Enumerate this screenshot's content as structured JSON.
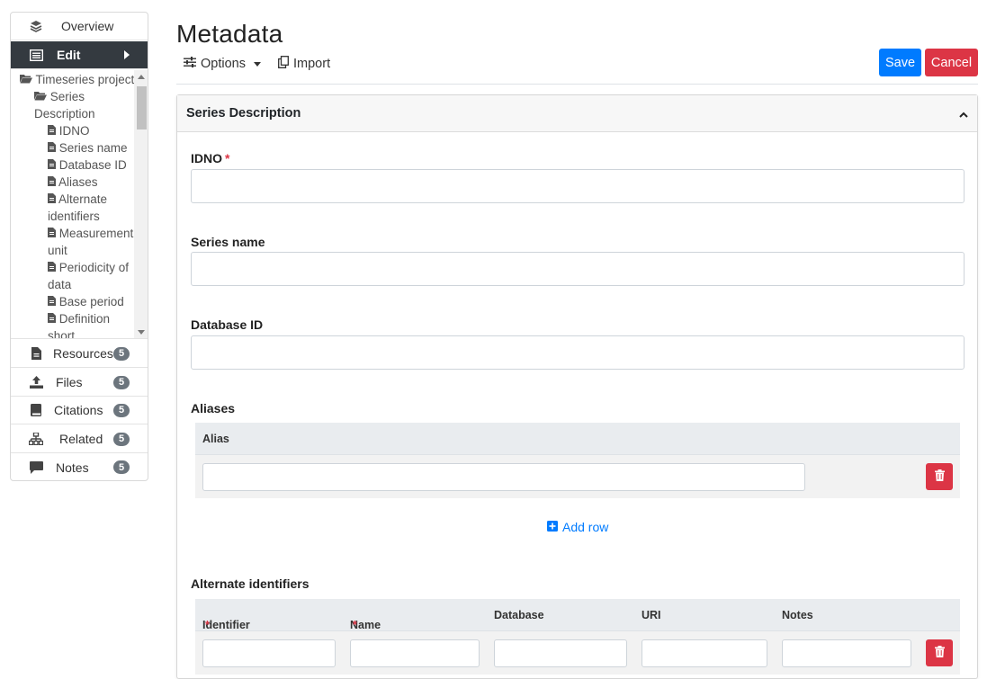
{
  "sidebar": {
    "overview": "Overview",
    "edit": "Edit",
    "tree": {
      "project": "Timeseries project",
      "series_desc_1": "Series",
      "series_desc_2": "Description",
      "items": [
        "IDNO",
        "Series name",
        "Database ID",
        "Aliases",
        "Alternate",
        "identifiers",
        "Measurement",
        "unit",
        "Periodicity of",
        "data",
        "Base period",
        "Definition",
        "short"
      ]
    },
    "resources": {
      "label": "Resources",
      "count": "5"
    },
    "files": {
      "label": "Files",
      "count": "5"
    },
    "citations": {
      "label": "Citations",
      "count": "5"
    },
    "related": {
      "label": "Related",
      "count": "5"
    },
    "notes": {
      "label": "Notes",
      "count": "5"
    }
  },
  "header": {
    "title": "Metadata",
    "options": "Options",
    "import": "Import",
    "save": "Save",
    "cancel": "Cancel"
  },
  "section": {
    "title": "Series Description",
    "idno_label": "IDNO",
    "series_name_label": "Series name",
    "database_id_label": "Database ID",
    "aliases_label": "Aliases",
    "alias_col": "Alias",
    "add_row": "Add row",
    "alt_ids_label": "Alternate identifiers",
    "alt_cols": {
      "identifier": "Identifier",
      "name": "Name",
      "database": "Database",
      "uri": "URI",
      "notes": "Notes"
    },
    "required_mark": "*"
  },
  "colors": {
    "save": "#007bff",
    "cancel": "#dc3545",
    "active_nav": "#343a40",
    "badge": "#6c757d"
  }
}
